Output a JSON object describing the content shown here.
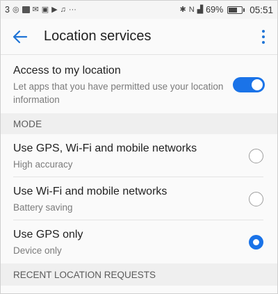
{
  "status_bar": {
    "left_text": "3",
    "more_dots": "···",
    "battery_text": "69%",
    "battery_level": 0.69,
    "time": "05:51"
  },
  "app_bar": {
    "title": "Location services"
  },
  "access": {
    "title": "Access to my location",
    "subtitle": "Let apps that you have permitted use your location information",
    "enabled": true
  },
  "mode_section": {
    "header": "MODE",
    "options": [
      {
        "title": "Use GPS, Wi-Fi and mobile networks",
        "subtitle": "High accuracy",
        "selected": false
      },
      {
        "title": "Use Wi-Fi and mobile networks",
        "subtitle": "Battery saving",
        "selected": false
      },
      {
        "title": "Use GPS only",
        "subtitle": "Device only",
        "selected": true
      }
    ]
  },
  "recent_section": {
    "header": "RECENT LOCATION REQUESTS"
  },
  "colors": {
    "accent": "#1a73e8",
    "section_bg": "#efefef"
  }
}
